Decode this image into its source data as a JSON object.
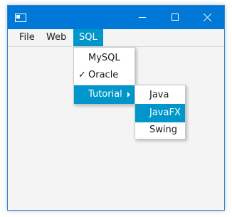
{
  "menubar": {
    "items": [
      "File",
      "Web",
      "SQL"
    ]
  },
  "sql_menu": {
    "items": [
      {
        "label": "MySQL",
        "checked": false
      },
      {
        "label": "Oracle",
        "checked": true
      },
      {
        "label": "Tutorial",
        "has_submenu": true,
        "highlighted": true
      }
    ],
    "check_glyph": "✓"
  },
  "tutorial_submenu": {
    "items": [
      {
        "label": "Java",
        "highlighted": false
      },
      {
        "label": "JavaFX",
        "highlighted": true
      },
      {
        "label": "Swing",
        "highlighted": false
      }
    ]
  },
  "colors": {
    "titlebar": "#0078d7",
    "highlight": "#0096c9",
    "window_bg": "#f4f4f4"
  }
}
